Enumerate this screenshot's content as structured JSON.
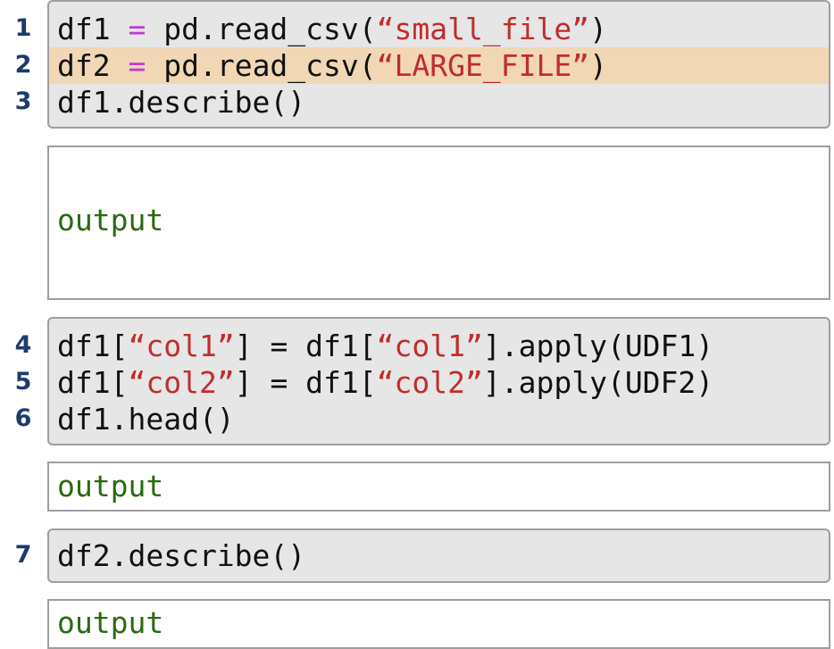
{
  "colors": {
    "line_number": "#1d3b6e",
    "cell_bg": "#e6e6e6",
    "highlight_bg": "#f1d7b5",
    "operator": "#c03bd8",
    "string": "#c22c2c",
    "output_text": "#2a6a12"
  },
  "cells": [
    {
      "lines": [
        {
          "num": "1",
          "pre": "df1 ",
          "eq": "=",
          "mid": " pd.read_csv(",
          "str": "“small_file”",
          "post": ")"
        },
        {
          "num": "2",
          "pre": "df2 ",
          "eq": "=",
          "mid": " pd.read_csv(",
          "str": "“LARGE_FILE”",
          "post": ")",
          "highlighted": true
        },
        {
          "num": "3",
          "text": "df1.describe()"
        }
      ],
      "output": "output"
    },
    {
      "lines": [
        {
          "num": "4",
          "a": "df1[",
          "s1": "“col1”",
          "b": "] = df1[",
          "s2": "“col1”",
          "c": "].apply(UDF1)"
        },
        {
          "num": "5",
          "a": "df1[",
          "s1": "“col2”",
          "b": "] = df1[",
          "s2": "“col2”",
          "c": "].apply(UDF2)"
        },
        {
          "num": "6",
          "text": "df1.head()"
        }
      ],
      "output": "output"
    },
    {
      "lines": [
        {
          "num": "7",
          "text": "df2.describe()"
        }
      ],
      "output": "output"
    }
  ]
}
